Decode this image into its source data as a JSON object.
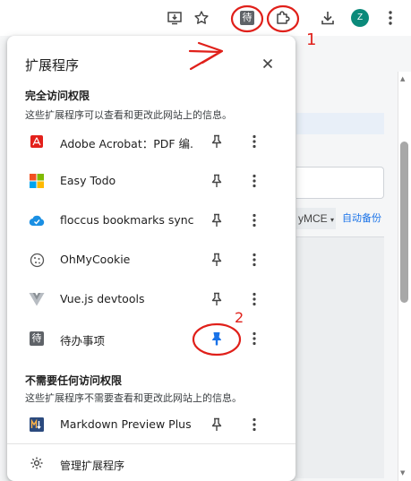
{
  "popup": {
    "title": "扩展程序",
    "sections": [
      {
        "title": "完全访问权限",
        "description": "这些扩展程序可以查看和更改此网站上的信息。",
        "items": [
          {
            "name": "Adobe Acrobat：PDF 编...",
            "icon": "adobe-acrobat-icon",
            "pinned": false
          },
          {
            "name": "Easy Todo",
            "icon": "easy-todo-icon",
            "pinned": false
          },
          {
            "name": "floccus bookmarks sync",
            "icon": "floccus-icon",
            "pinned": false
          },
          {
            "name": "OhMyCookie",
            "icon": "cookie-icon",
            "pinned": false
          },
          {
            "name": "Vue.js devtools",
            "icon": "vue-icon",
            "pinned": false
          },
          {
            "name": "待办事项",
            "icon": "todo-icon",
            "pinned": true
          }
        ]
      },
      {
        "title": "不需要任何访问权限",
        "description": "这些扩展程序不需要查看和更改此网站上的信息。",
        "items": [
          {
            "name": "Markdown Preview Plus",
            "icon": "markdown-icon",
            "pinned": false
          }
        ]
      }
    ],
    "footer_label": "管理扩展程序"
  },
  "toolbar": {
    "pinned_extension_glyph": "待",
    "avatar_letter": "Z"
  },
  "background_page": {
    "select_value": "yMCE",
    "link_label": "自动备份"
  },
  "annotations": [
    "1",
    "2"
  ],
  "colors": {
    "pin_active": "#1a73e8",
    "annotation": "#e0201a",
    "avatar": "#0b8a7a"
  }
}
